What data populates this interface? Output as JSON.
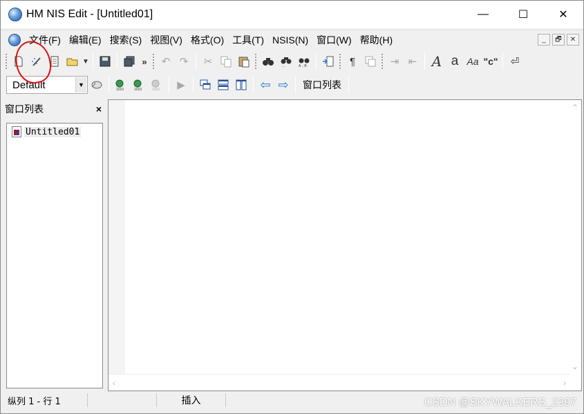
{
  "window": {
    "title": "HM NIS Edit - [Untitled01]",
    "controls": {
      "minimize": "—",
      "maximize": "☐",
      "close": "✕"
    }
  },
  "menubar": {
    "items": [
      "文件(F)",
      "编辑(E)",
      "搜索(S)",
      "视图(V)",
      "格式(O)",
      "工具(T)",
      "NSIS(N)",
      "窗口(W)",
      "帮助(H)"
    ],
    "mdi": {
      "minimize": "_",
      "restore": "🗗",
      "close": "✕"
    }
  },
  "toolbar1": {
    "more": "»",
    "icons": [
      "new-file-icon",
      "wizard-icon",
      "template-icon",
      "open-folder-icon",
      "save-icon",
      "save-all-icon",
      "undo-icon",
      "redo-icon",
      "cut-icon",
      "copy-icon",
      "paste-icon",
      "find-icon",
      "find-next-icon",
      "replace-icon",
      "insert-file-icon",
      "paragraph-icon",
      "multi-window-icon",
      "indent-icon",
      "outdent-icon",
      "font-icon",
      "lowercase-icon",
      "font-style-icon",
      "string-icon",
      "word-wrap-icon"
    ]
  },
  "toolbar2": {
    "dropdown_value": "Default",
    "window_list_label": "窗口列表"
  },
  "panel": {
    "title": "窗口列表",
    "close": "×",
    "items": [
      "Untitled01"
    ]
  },
  "statusbar": {
    "position": "纵列 1 - 行 1",
    "mode": "插入"
  },
  "watermark": "CSDN @SKYWALKERS_2397",
  "colors": {
    "annotation": "#d11111",
    "window_bg": "#f0f0f0",
    "editor_bg": "#ffffff"
  }
}
